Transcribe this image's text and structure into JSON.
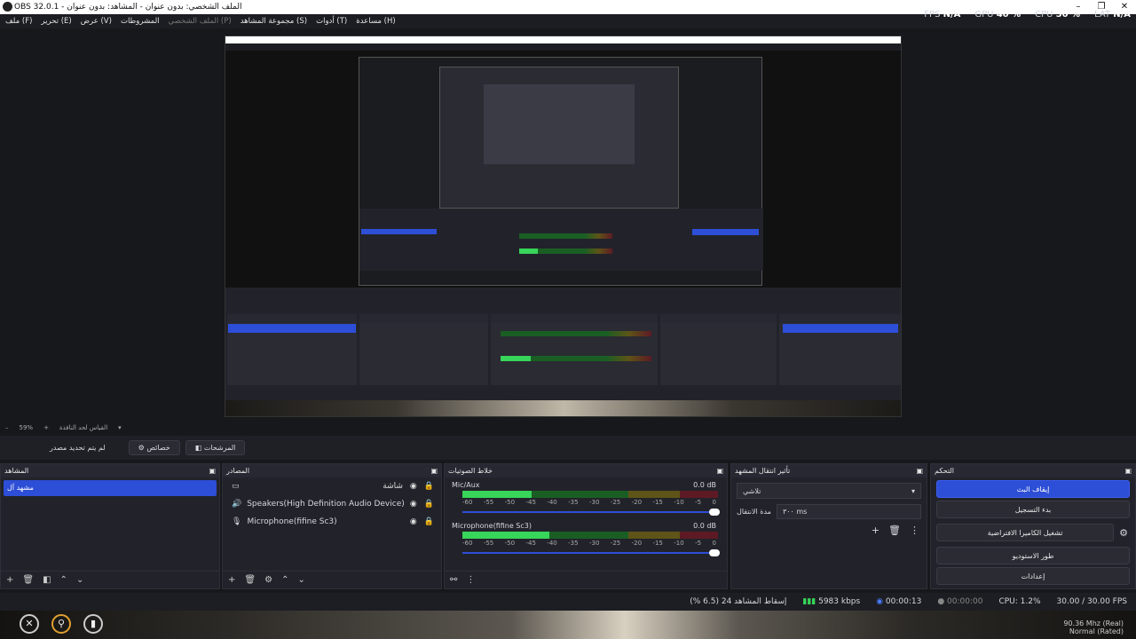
{
  "title_bar": {
    "title": "OBS 32.0.1 - الملف الشخصي: بدون عنوان - المشاهد: بدون عنوان"
  },
  "menu": [
    "ملف (F)",
    "تحرير (E)",
    "عرض (V)",
    "المشروطات",
    "الملف الشخصي (P)",
    "مجموعة المشاهد (S)",
    "أدوات (T)",
    "مساعدة (H)"
  ],
  "stats": {
    "fps_label": "FPS",
    "fps_value": "N/A",
    "gpu_label": "GPU",
    "gpu_value": "40 %",
    "cpu_label": "CPU",
    "cpu_value": "50 %",
    "lat_label": "LAT",
    "lat_value": "N/A"
  },
  "zoom": {
    "value": "59%",
    "text": "القياس لحد النافذة"
  },
  "toolbar": {
    "no_source": "لم يتم تحديد مصدر",
    "properties": "خصائص",
    "filters": "المرشحات"
  },
  "docks": {
    "scenes": {
      "title": "المشاهد",
      "items": [
        "مشهد آل"
      ]
    },
    "sources": {
      "title": "المصادر",
      "items": [
        {
          "label": "شاشة",
          "icon": "monitor-icon"
        },
        {
          "label": "Speakers(High Definition Audio Device)",
          "icon": "speaker-icon"
        },
        {
          "label": "Microphone(fifine Sc3)",
          "icon": "microphone-icon"
        }
      ]
    },
    "mixer": {
      "title": "خلاط الصوتيات",
      "channels": [
        {
          "name": "Mic/Aux",
          "db": "0.0 dB",
          "level": 0.27
        },
        {
          "name": "Microphone(fifine Sc3)",
          "db": "0.0 dB",
          "level": 0.34
        }
      ],
      "ticks": [
        "-60",
        "-55",
        "-50",
        "-45",
        "-40",
        "-35",
        "-30",
        "-25",
        "-20",
        "-15",
        "-10",
        "-5",
        "0"
      ]
    },
    "transitions": {
      "title": "تأثير انتقال المشهد",
      "selected": "تلاشي",
      "duration_label": "مدة الانتقال",
      "duration_value": "٣٠٠ ms"
    },
    "controls": {
      "title": "التحكم",
      "buttons": [
        "إيقاف البث",
        "بدء التسجيل",
        "تشغيل الكاميرا الافتراضية",
        "طور الاستوديو",
        "إعدادات"
      ]
    }
  },
  "status": {
    "dropped": "إسقاط المشاهد 24 (6.5 %)",
    "bitrate": "5983 kbps",
    "stream_time": "00:00:13",
    "rec_time": "00:00:00",
    "cpu": "CPU: 1.2%",
    "fps": "30.00 / 30.00 FPS"
  },
  "sysinfo": {
    "line1": "90.36 Mhz (Real)",
    "line2": "Normal (Rated)"
  }
}
